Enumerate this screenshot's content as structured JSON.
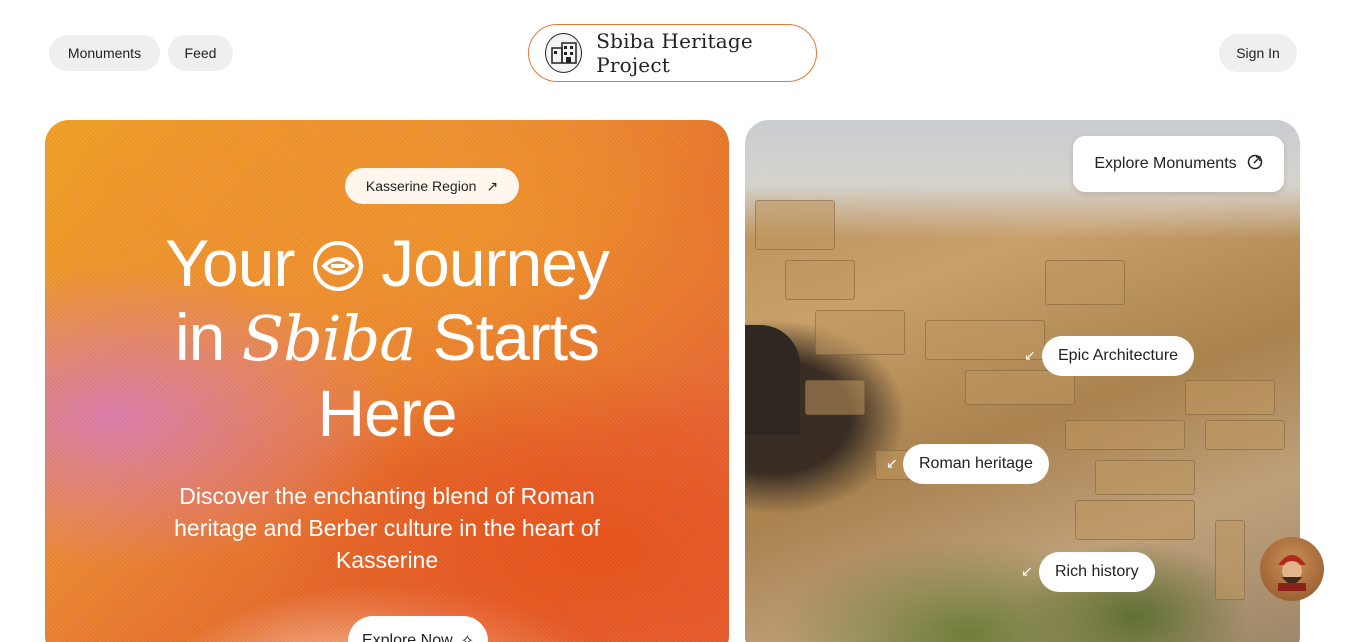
{
  "nav": {
    "monuments_label": "Monuments",
    "feed_label": "Feed",
    "brand_name": "Sbiba Heritage Project",
    "sign_in_label": "Sign In",
    "brand_color": "#e07a37"
  },
  "hero": {
    "region_tag": "Kasserine Region",
    "headline_your": "Your",
    "headline_journey": "Journey",
    "headline_in": "in",
    "headline_sbiba": "Sbiba",
    "headline_starts": "Starts",
    "headline_here": "Here",
    "subtitle": "Discover the enchanting blend of Roman heritage and Berber culture in the heart of Kasserine",
    "cta_label": "Explore Now"
  },
  "photo": {
    "explore_label": "Explore Monuments",
    "tags": [
      {
        "label": "Epic Architecture"
      },
      {
        "label": "Roman heritage"
      },
      {
        "label": "Rich history"
      }
    ]
  },
  "icons": {
    "brand_logo": "building-icon",
    "region_arrow": "arrow-up-right-icon",
    "headline_glyph": "eye-icon",
    "cta_icon": "sparkle-icon",
    "explore_icon": "external-link-icon",
    "tag_arrow": "arrow-down-left-icon",
    "assistant": "avatar"
  }
}
